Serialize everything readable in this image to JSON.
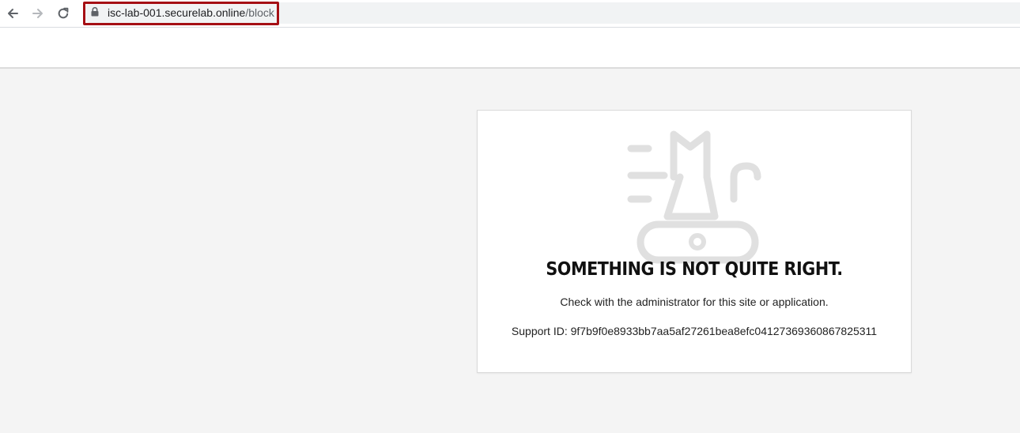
{
  "browser": {
    "icons": [
      "back-arrow-icon",
      "forward-arrow-icon",
      "reload-icon",
      "lock-icon"
    ],
    "url_host": "isc-lab-001.securelab.online",
    "url_path": "/block",
    "highlight_color": "#a50f14"
  },
  "block_page": {
    "illustration_icon": "cat-on-treadmill-icon",
    "heading": "SOMETHING IS NOT QUITE RIGHT.",
    "message": "Check with the administrator for this site or application.",
    "support_label": "Support ID:",
    "support_id": "9f7b9f0e8933bb7aa5af27261bea8efc04127369360867825311"
  }
}
